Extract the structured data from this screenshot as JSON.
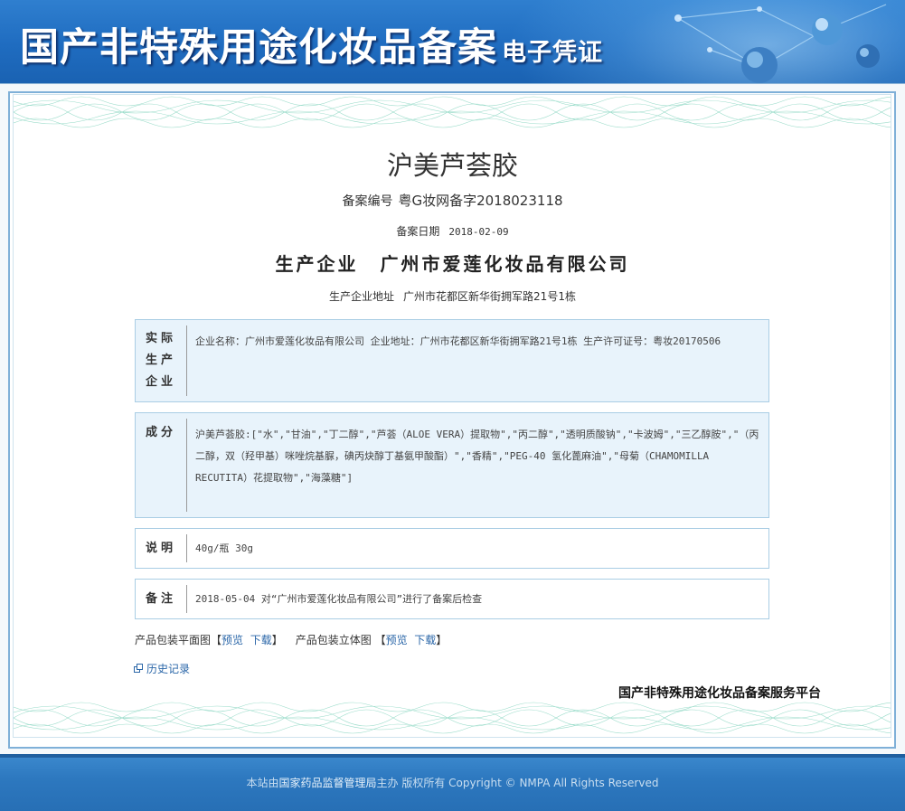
{
  "header": {
    "title": "国产非特殊用途化妆品备案",
    "subtitle": "电子凭证"
  },
  "product": {
    "name": "沪美芦荟胶",
    "registration_label": "备案编号",
    "registration_number": "粤G妆网备字2018023118",
    "date_label": "备案日期",
    "date": "2018-02-09",
    "manufacturer_label": "生产企业",
    "manufacturer": "广州市爱莲化妆品有限公司",
    "address_label": "生产企业地址",
    "address": "广州市花都区新华街拥军路21号1栋"
  },
  "sections": {
    "actual_producer": {
      "label": "实际生产企业",
      "label_lines": [
        "实际",
        "生产",
        "企业"
      ],
      "text": "企业名称：广州市爱莲化妆品有限公司  企业地址：广州市花都区新华街拥军路21号1栋  生产许可证号：粤妆20170506"
    },
    "ingredients": {
      "label": "成分",
      "text": "沪美芦荟胶:[\"水\",\"甘油\",\"丁二醇\",\"芦荟（ALOE VERA）提取物\",\"丙二醇\",\"透明质酸钠\",\"卡波姆\",\"三乙醇胺\",\"（丙二醇，双（羟甲基）咪唑烷基脲，碘丙炔醇丁基氨甲酸酯）\",\"香精\",\"PEG-40 氢化蓖麻油\",\"母菊（CHAMOMILLA RECUTITA）花提取物\",\"海藻糖\"]"
    },
    "description": {
      "label": "说明",
      "text": "40g/瓶 30g"
    },
    "remarks": {
      "label": "备注",
      "text": "2018-05-04 对“广州市爱莲化妆品有限公司”进行了备案后检查"
    }
  },
  "packaging": {
    "flat_label": "产品包装平面图",
    "solid_label": "产品包装立体图",
    "preview": "预览",
    "download": "下载",
    "bracket_open": "【",
    "bracket_close": "】"
  },
  "history_link": "历史记录",
  "platform_name": "国产非特殊用途化妆品备案服务平台",
  "footer": {
    "prefix": "本站由",
    "org": "国家药品监督管理局",
    "suffix": "主办 版权所有 Copyright © NMPA All Rights Reserved"
  },
  "colors": {
    "banner_blue": "#1f6cc0",
    "box_border": "#a9cde4",
    "box_fill": "#e8f3fb",
    "link": "#2a66a8",
    "guilloche": "#8fd8c4"
  }
}
